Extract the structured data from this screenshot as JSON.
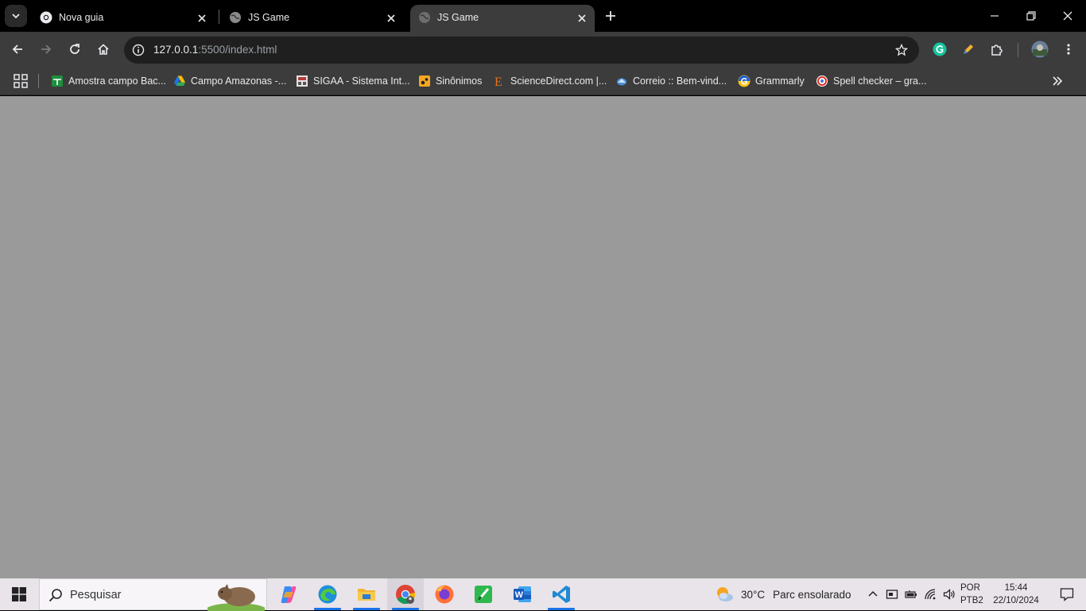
{
  "browser": {
    "tabs": [
      {
        "title": "Nova guia",
        "favicon": "chrome-icon",
        "active": false
      },
      {
        "title": "JS Game",
        "favicon": "globe-icon",
        "active": false
      },
      {
        "title": "JS Game",
        "favicon": "globe-icon",
        "active": true
      }
    ],
    "address": {
      "host": "127.0.0.1",
      "rest": ":5500/index.html"
    },
    "bookmarks": [
      {
        "label": "Amostra campo Bac...",
        "icon": "sheets-icon",
        "color": "#1e8e3e"
      },
      {
        "label": "Campo Amazonas -...",
        "icon": "drive-icon",
        "color": "#fbbc04"
      },
      {
        "label": "SIGAA - Sistema Int...",
        "icon": "sigaa-icon",
        "color": "#b23b3b"
      },
      {
        "label": "Sinônimos",
        "icon": "sinonimos-icon",
        "color": "#f5a623"
      },
      {
        "label": "ScienceDirect.com |...",
        "icon": "elsevier-icon",
        "color": "#e9711c"
      },
      {
        "label": "Correio :: Bem-vind...",
        "icon": "mail-icon",
        "color": "#4a90d9"
      },
      {
        "label": "Grammarly",
        "icon": "grammarly-icon",
        "color": "#15c39a"
      },
      {
        "label": "Spell checker – gra...",
        "icon": "spellcheck-icon",
        "color": "#d93025"
      }
    ]
  },
  "page": {
    "background": "#9a9a9a"
  },
  "taskbar": {
    "search_placeholder": "Pesquisar",
    "apps": [
      "copilot-icon",
      "edge-icon",
      "file-explorer-icon",
      "chrome-icon",
      "firefox-icon",
      "green-app-icon",
      "word-icon",
      "vscode-icon"
    ],
    "weather": {
      "temp": "30°C",
      "condition": "Parc ensolarado"
    },
    "language": {
      "line1": "POR",
      "line2": "PTB2"
    },
    "clock": {
      "time": "15:44",
      "date": "22/10/2024"
    }
  }
}
